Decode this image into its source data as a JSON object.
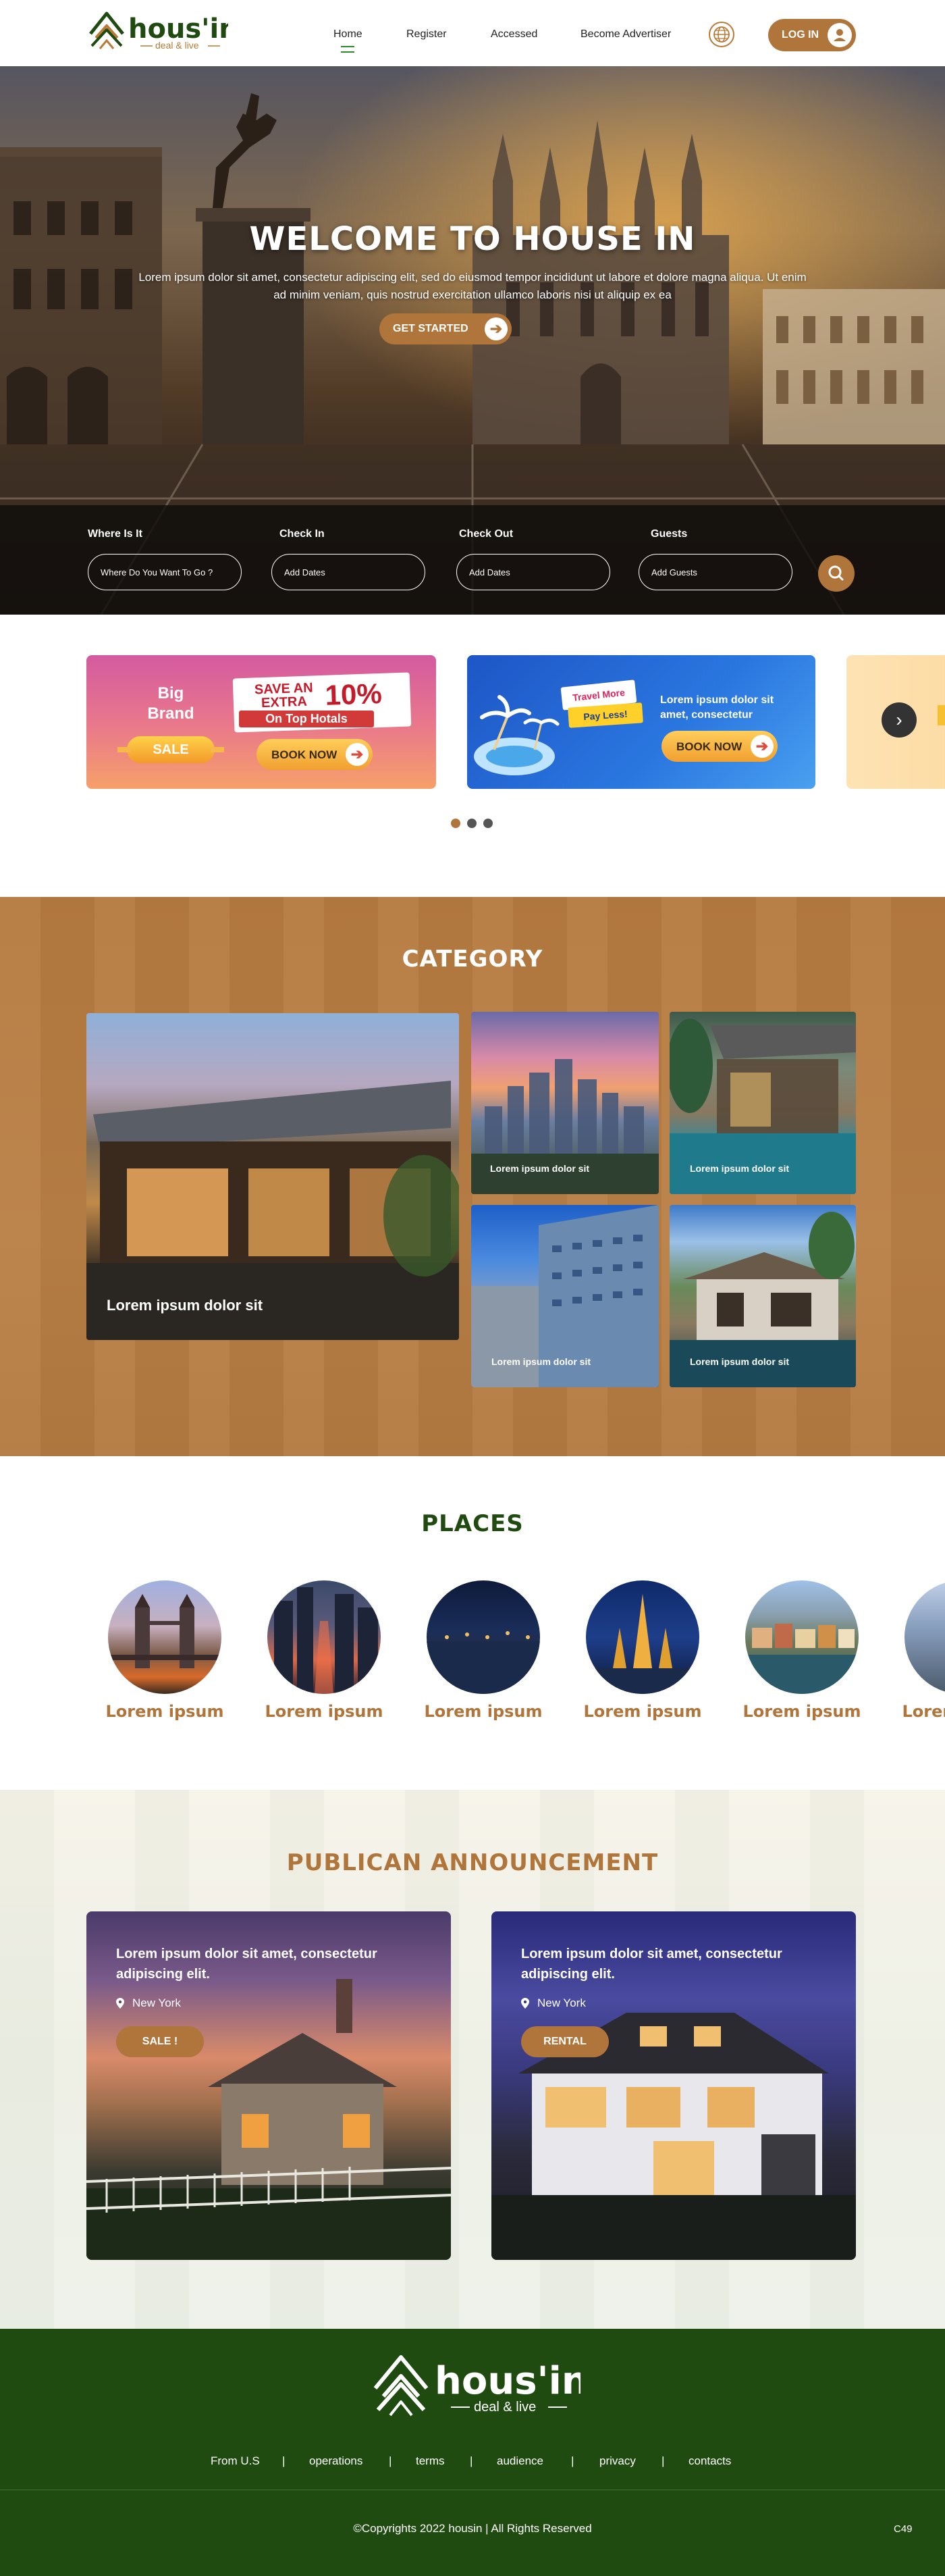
{
  "header": {
    "logo": {
      "name": "hous'in.",
      "tagline": "deal & live"
    },
    "nav": [
      {
        "label": "Home",
        "active": true
      },
      {
        "label": "Register",
        "active": false
      },
      {
        "label": "Accessed",
        "active": false
      },
      {
        "label": "Become Advertiser",
        "active": false
      }
    ],
    "language_icon": "globe-icon",
    "login_label": "LOG IN",
    "login_icon": "user-icon"
  },
  "hero": {
    "title": "WELCOME TO HOUSE IN",
    "text": "Lorem ipsum dolor sit amet, consectetur adipiscing elit, sed do eiusmod tempor incididunt ut labore et dolore magna aliqua. Ut enim ad minim veniam, quis nostrud exercitation ullamco laboris nisi ut aliquip ex ea",
    "cta_label": "GET STARTED",
    "search": {
      "where_label": "Where Is It",
      "where_placeholder": "Where Do You Want To Go ?",
      "checkin_label": "Check In",
      "checkin_placeholder": "Add Dates",
      "checkout_label": "Check Out",
      "checkout_placeholder": "Add Dates",
      "guests_label": "Guests",
      "guests_placeholder": "Add Guests",
      "search_icon": "search-icon"
    }
  },
  "promo": {
    "card1": {
      "brand": "Big Brand",
      "sale": "SALE",
      "save_line": "SAVE AN EXTRA",
      "percent": "10%",
      "subline": "On Top Hotals",
      "book_label": "BOOK NOW"
    },
    "card2": {
      "tag1": "Travel More",
      "tag2": "Pay Less!",
      "text": "Lorem ipsum dolor sit amet, consectetur",
      "book_label": "BOOK NOW"
    },
    "next_icon": "chevron-right-icon",
    "slides": 3,
    "active_slide": 1
  },
  "category": {
    "title": "CATEGORY",
    "items": [
      {
        "label": "Lorem ipsum dolor sit"
      },
      {
        "label": "Lorem ipsum dolor sit"
      },
      {
        "label": "Lorem ipsum dolor sit"
      },
      {
        "label": "Lorem ipsum dolor sit"
      },
      {
        "label": "Lorem ipsum dolor sit"
      }
    ]
  },
  "places": {
    "title": "PLACES",
    "items": [
      {
        "label": "Lorem ipsum"
      },
      {
        "label": "Lorem ipsum"
      },
      {
        "label": "Lorem ipsum"
      },
      {
        "label": "Lorem ipsum"
      },
      {
        "label": "Lorem ipsum"
      },
      {
        "label": "Lorem ipsum"
      }
    ]
  },
  "announcement": {
    "title": "PUBLICAN ANNOUNCEMENT",
    "cards": [
      {
        "headline": "Lorem ipsum dolor sit amet, consectetur adipiscing elit.",
        "location": "New York",
        "button": "SALE !"
      },
      {
        "headline": "Lorem ipsum dolor sit amet, consectetur adipiscing elit.",
        "location": "New York",
        "button": "RENTAL"
      }
    ]
  },
  "footer": {
    "logo": {
      "name": "hous'in.",
      "tagline": "deal & live"
    },
    "links": [
      "From U.S",
      "operations",
      "terms",
      "audience",
      "privacy",
      "contacts"
    ],
    "copyright": "©Copyrights 2022  housin | All Rights Reserved",
    "corner": "C49"
  },
  "colors": {
    "brand_green": "#1f4a10",
    "brand_brown": "#b0753a",
    "accent_active": "#2d8a2a"
  }
}
